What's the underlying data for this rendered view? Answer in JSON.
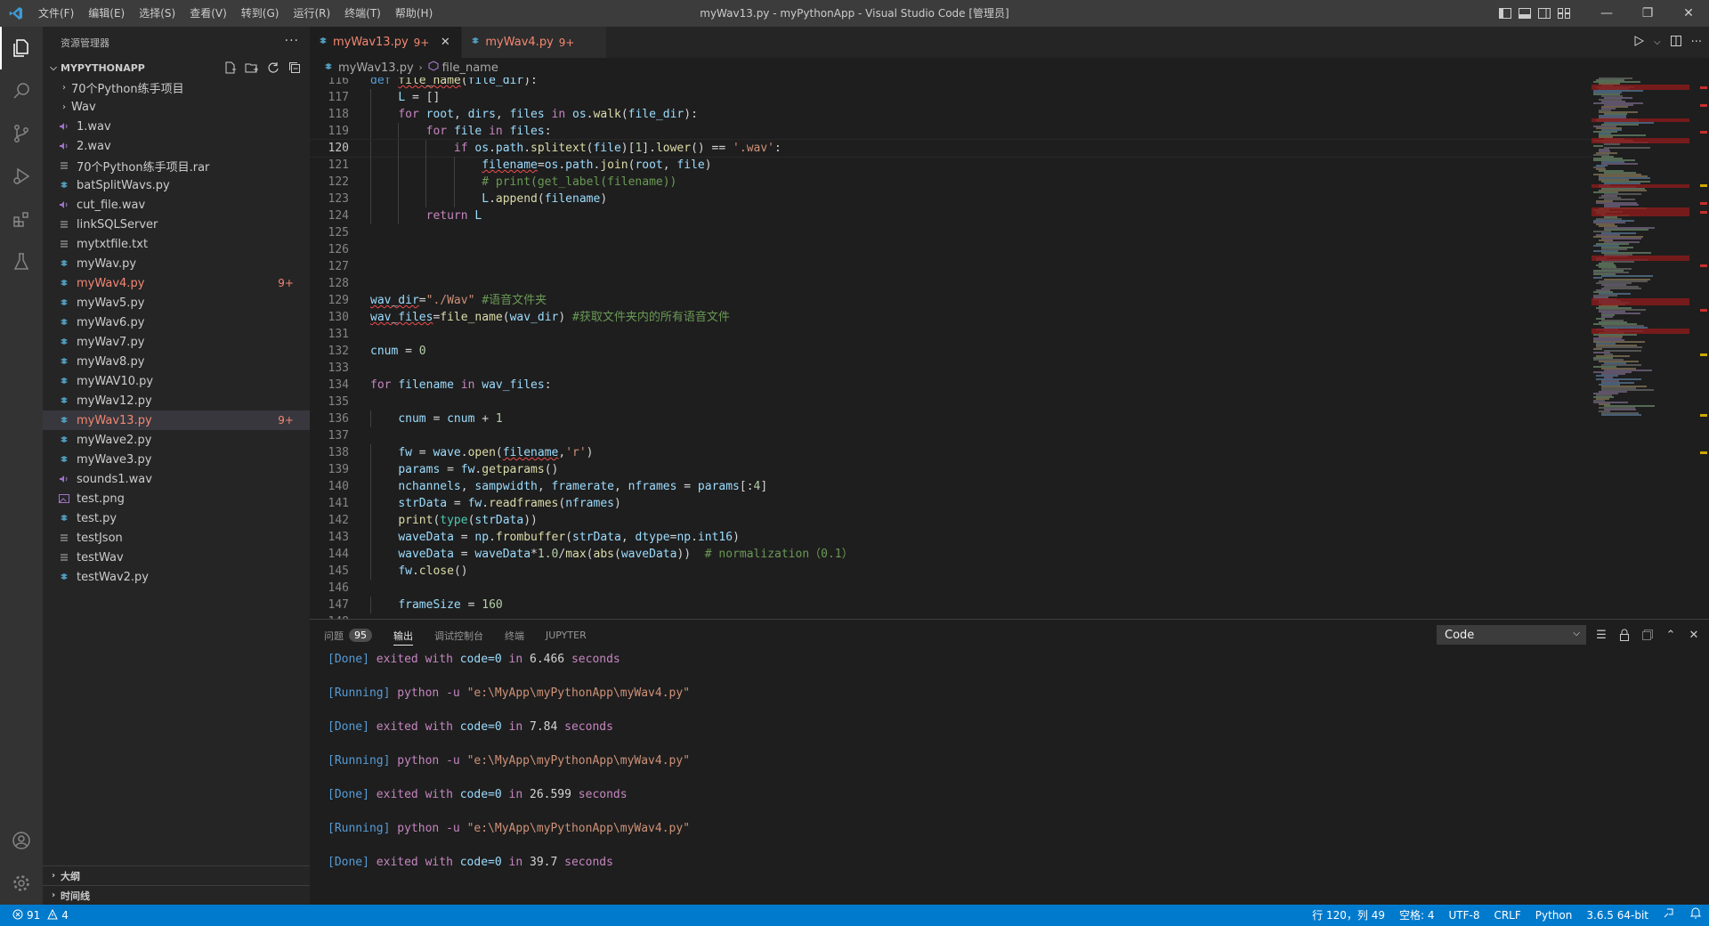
{
  "window": {
    "title": "myWav13.py - myPythonApp - Visual Studio Code [管理员]",
    "menu": [
      "文件(F)",
      "编辑(E)",
      "选择(S)",
      "查看(V)",
      "转到(G)",
      "运行(R)",
      "终端(T)",
      "帮助(H)"
    ]
  },
  "sidebar": {
    "header": "资源管理器",
    "more": "···",
    "project": "MYPYTHONAPP",
    "items": [
      {
        "label": "70个Python练手项目",
        "type": "folder",
        "badge": ""
      },
      {
        "label": "Wav",
        "type": "folder",
        "badge": ""
      },
      {
        "label": "1.wav",
        "type": "audio",
        "badge": ""
      },
      {
        "label": "2.wav",
        "type": "audio",
        "badge": ""
      },
      {
        "label": "70个Python练手项目.rar",
        "type": "file",
        "badge": ""
      },
      {
        "label": "batSplitWavs.py",
        "type": "python",
        "badge": ""
      },
      {
        "label": "cut_file.wav",
        "type": "audio",
        "badge": ""
      },
      {
        "label": "linkSQLServer",
        "type": "file",
        "badge": ""
      },
      {
        "label": "mytxtfile.txt",
        "type": "file",
        "badge": ""
      },
      {
        "label": "myWav.py",
        "type": "python",
        "badge": ""
      },
      {
        "label": "myWav4.py",
        "type": "python",
        "badge": "9+"
      },
      {
        "label": "myWav5.py",
        "type": "python",
        "badge": ""
      },
      {
        "label": "myWav6.py",
        "type": "python",
        "badge": ""
      },
      {
        "label": "myWav7.py",
        "type": "python",
        "badge": ""
      },
      {
        "label": "myWav8.py",
        "type": "python",
        "badge": ""
      },
      {
        "label": "myWAV10.py",
        "type": "python",
        "badge": ""
      },
      {
        "label": "myWav12.py",
        "type": "python",
        "badge": ""
      },
      {
        "label": "myWav13.py",
        "type": "python",
        "badge": "9+"
      },
      {
        "label": "myWave2.py",
        "type": "python",
        "badge": ""
      },
      {
        "label": "myWave3.py",
        "type": "python",
        "badge": ""
      },
      {
        "label": "sounds1.wav",
        "type": "audio",
        "badge": ""
      },
      {
        "label": "test.png",
        "type": "image",
        "badge": ""
      },
      {
        "label": "test.py",
        "type": "python",
        "badge": ""
      },
      {
        "label": "testJson",
        "type": "file",
        "badge": ""
      },
      {
        "label": "testWav",
        "type": "file",
        "badge": ""
      },
      {
        "label": "testWav2.py",
        "type": "python",
        "badge": ""
      }
    ],
    "outline": "大纲",
    "timeline": "时间线"
  },
  "tabs": [
    {
      "label": "myWav13.py",
      "count": "9+",
      "active": true
    },
    {
      "label": "myWav4.py",
      "count": "9+",
      "active": false
    }
  ],
  "breadcrumb": {
    "file": "myWav13.py",
    "symbol": "file_name"
  },
  "editor": {
    "lines": [
      "116",
      "117",
      "118",
      "119",
      "120",
      "121",
      "122",
      "123",
      "124",
      "125",
      "126",
      "127",
      "128",
      "129",
      "130",
      "131",
      "132",
      "133",
      "134",
      "135",
      "136",
      "137",
      "138",
      "139",
      "140",
      "141",
      "142",
      "143",
      "144",
      "145",
      "146",
      "147",
      "148"
    ]
  },
  "panel": {
    "tabs": [
      "问题",
      "输出",
      "调试控制台",
      "终端",
      "JUPYTER"
    ],
    "problems_count": "95",
    "select_value": "Code",
    "output": [
      {
        "kind": "done",
        "tag": "[Done]",
        "text": "exited with",
        "code": "code=0",
        "in": "in",
        "secs": "6.466",
        "unit": "seconds"
      },
      {
        "kind": "run",
        "tag": "[Running]",
        "cmd": "python -u",
        "path": "\"e:\\MyApp\\myPythonApp\\myWav4.py\""
      },
      {
        "kind": "done",
        "tag": "[Done]",
        "text": "exited with",
        "code": "code=0",
        "in": "in",
        "secs": "7.84",
        "unit": "seconds"
      },
      {
        "kind": "run",
        "tag": "[Running]",
        "cmd": "python -u",
        "path": "\"e:\\MyApp\\myPythonApp\\myWav4.py\""
      },
      {
        "kind": "done",
        "tag": "[Done]",
        "text": "exited with",
        "code": "code=0",
        "in": "in",
        "secs": "26.599",
        "unit": "seconds"
      },
      {
        "kind": "run",
        "tag": "[Running]",
        "cmd": "python -u",
        "path": "\"e:\\MyApp\\myPythonApp\\myWav4.py\""
      },
      {
        "kind": "done",
        "tag": "[Done]",
        "text": "exited with",
        "code": "code=0",
        "in": "in",
        "secs": "39.7",
        "unit": "seconds"
      }
    ]
  },
  "statusbar": {
    "errors": "91",
    "warnings": "4",
    "position": "行 120，列 49",
    "spaces": "空格: 4",
    "encoding": "UTF-8",
    "eol": "CRLF",
    "language": "Python",
    "interpreter": "3.6.5 64-bit"
  },
  "colors": {
    "accent": "#007acc",
    "error": "#f48771",
    "warning": "#cca700"
  }
}
